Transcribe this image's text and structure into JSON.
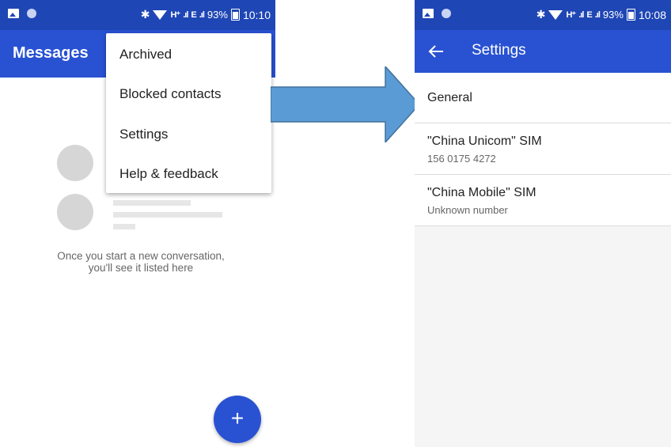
{
  "left": {
    "status": {
      "net": "H⁺",
      "net2": "E",
      "battery": "93%",
      "time": "10:10"
    },
    "appbar_title": "Messages",
    "menu": [
      "Archived",
      "Blocked contacts",
      "Settings",
      "Help & feedback"
    ],
    "empty_text": "Once you start a new conversation, you'll see it listed here",
    "fab_label": "+"
  },
  "right": {
    "status": {
      "net": "H⁺",
      "net2": "E",
      "battery": "93%",
      "time": "10:08"
    },
    "appbar_title": "Settings",
    "rows": [
      {
        "title": "General",
        "subtitle": ""
      },
      {
        "title": "\"China Unicom\" SIM",
        "subtitle": "156 0175 4272"
      },
      {
        "title": "\"China Mobile\" SIM",
        "subtitle": "Unknown number"
      }
    ]
  },
  "colors": {
    "status_bar": "#1f46b5",
    "app_bar": "#2952d2",
    "arrow": "#5b9bd5"
  }
}
